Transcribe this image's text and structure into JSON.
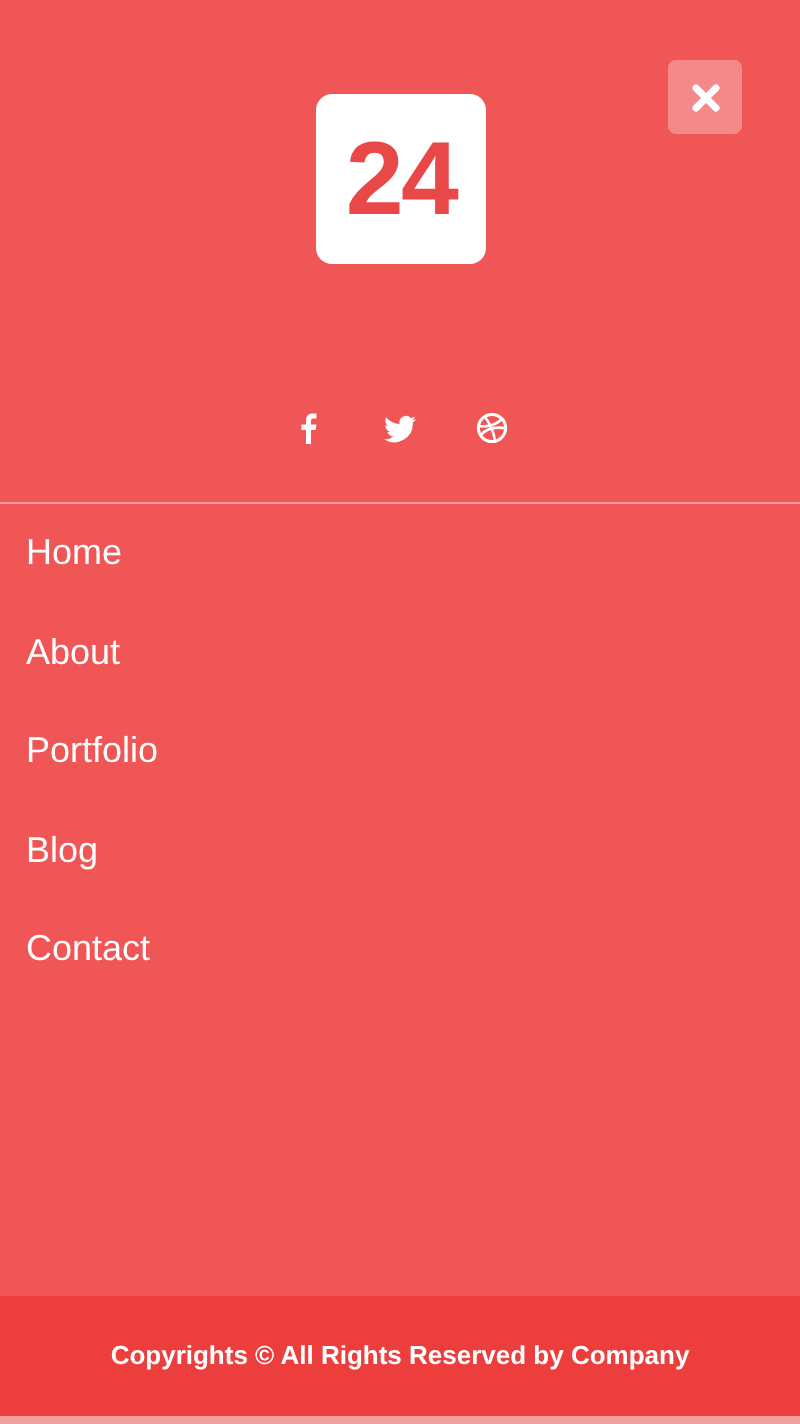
{
  "overlay": {
    "logo": "24",
    "social": [
      {
        "kind": "facebook"
      },
      {
        "kind": "twitter"
      },
      {
        "kind": "dribbble"
      }
    ],
    "menu": [
      {
        "label": "Home"
      },
      {
        "label": "About"
      },
      {
        "label": "Portfolio"
      },
      {
        "label": "Blog"
      },
      {
        "label": "Contact"
      }
    ]
  },
  "footer": {
    "text": "Copyrights © All Rights Reserved by Company"
  }
}
